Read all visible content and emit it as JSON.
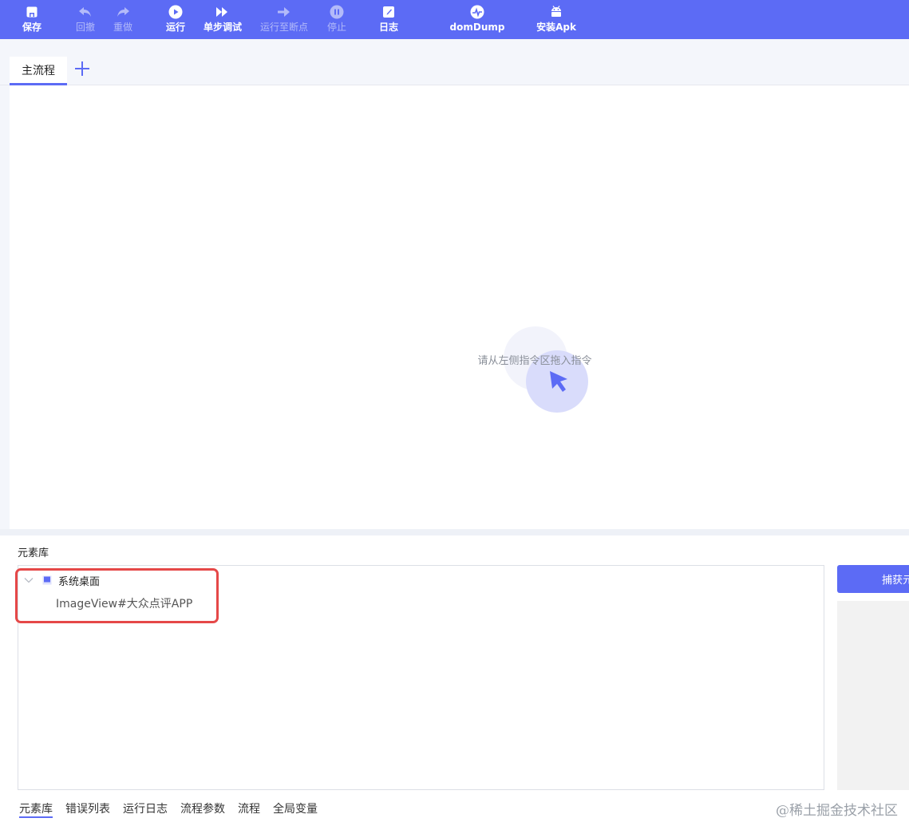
{
  "toolbar": {
    "save": "保存",
    "undo": "回撤",
    "redo": "重做",
    "run": "运行",
    "step_debug": "单步调试",
    "run_to_breakpoint": "运行至断点",
    "stop": "停止",
    "log": "日志",
    "dom_dump": "domDump",
    "install_apk": "安装Apk"
  },
  "tabs": {
    "main_flow": "主流程",
    "add_icon": "plus-icon"
  },
  "canvas": {
    "empty_hint": "请从左侧指令区拖入指令",
    "illustration_icon": "cursor-arrow-icon"
  },
  "element_library": {
    "title": "元素库",
    "tree": {
      "root_label": "系统桌面",
      "child_label": "ImageView#大众点评APP"
    },
    "capture_button": "捕获元"
  },
  "bottom_tabs": [
    "元素库",
    "错误列表",
    "运行日志",
    "流程参数",
    "流程",
    "全局变量"
  ],
  "watermark": "@稀土掘金技术社区",
  "colors": {
    "accent": "#5c6bf5",
    "highlight": "#e54848"
  }
}
